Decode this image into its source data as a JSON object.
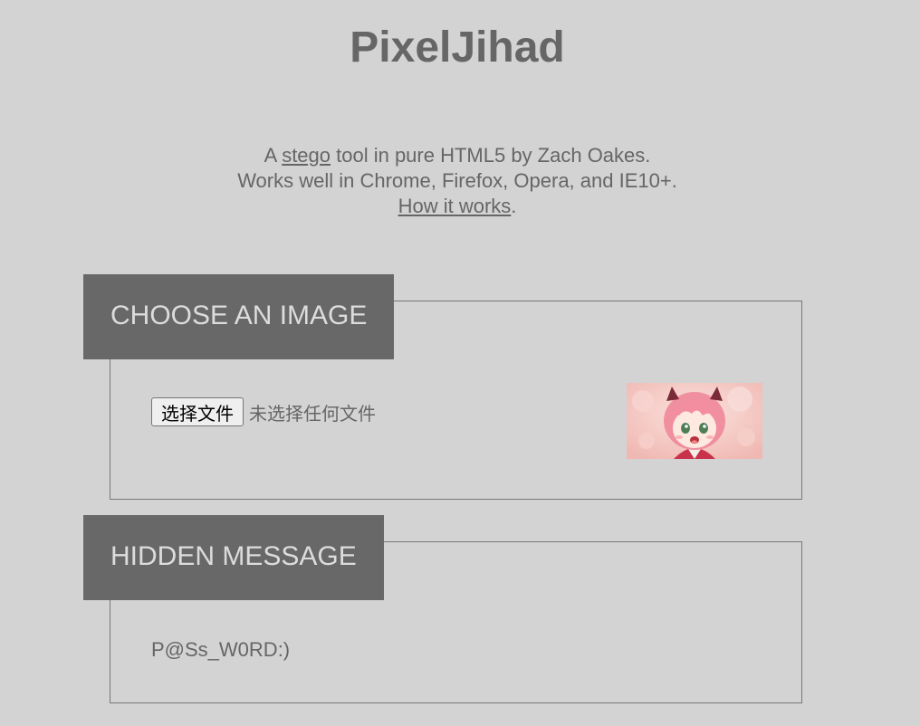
{
  "header": {
    "title": "PixelJihad"
  },
  "intro": {
    "line1_prefix": "A ",
    "line1_link": "stego",
    "line1_suffix": " tool in pure HTML5 by Zach Oakes.",
    "line2": "Works well in Chrome, Firefox, Opera, and IE10+.",
    "line3_link": "How it works",
    "line3_suffix": "."
  },
  "image_section": {
    "heading": "CHOOSE AN IMAGE",
    "file_button_label": "选择文件",
    "file_status": "未选择任何文件",
    "thumbnail_icon": "anime-girl-image"
  },
  "message_section": {
    "heading": "HIDDEN MESSAGE",
    "message_value": "P@Ss_W0RD:)"
  },
  "colors": {
    "background": "#d3d3d3",
    "text": "#666666",
    "header_bg": "#686868",
    "header_text": "#dcdcdc"
  }
}
